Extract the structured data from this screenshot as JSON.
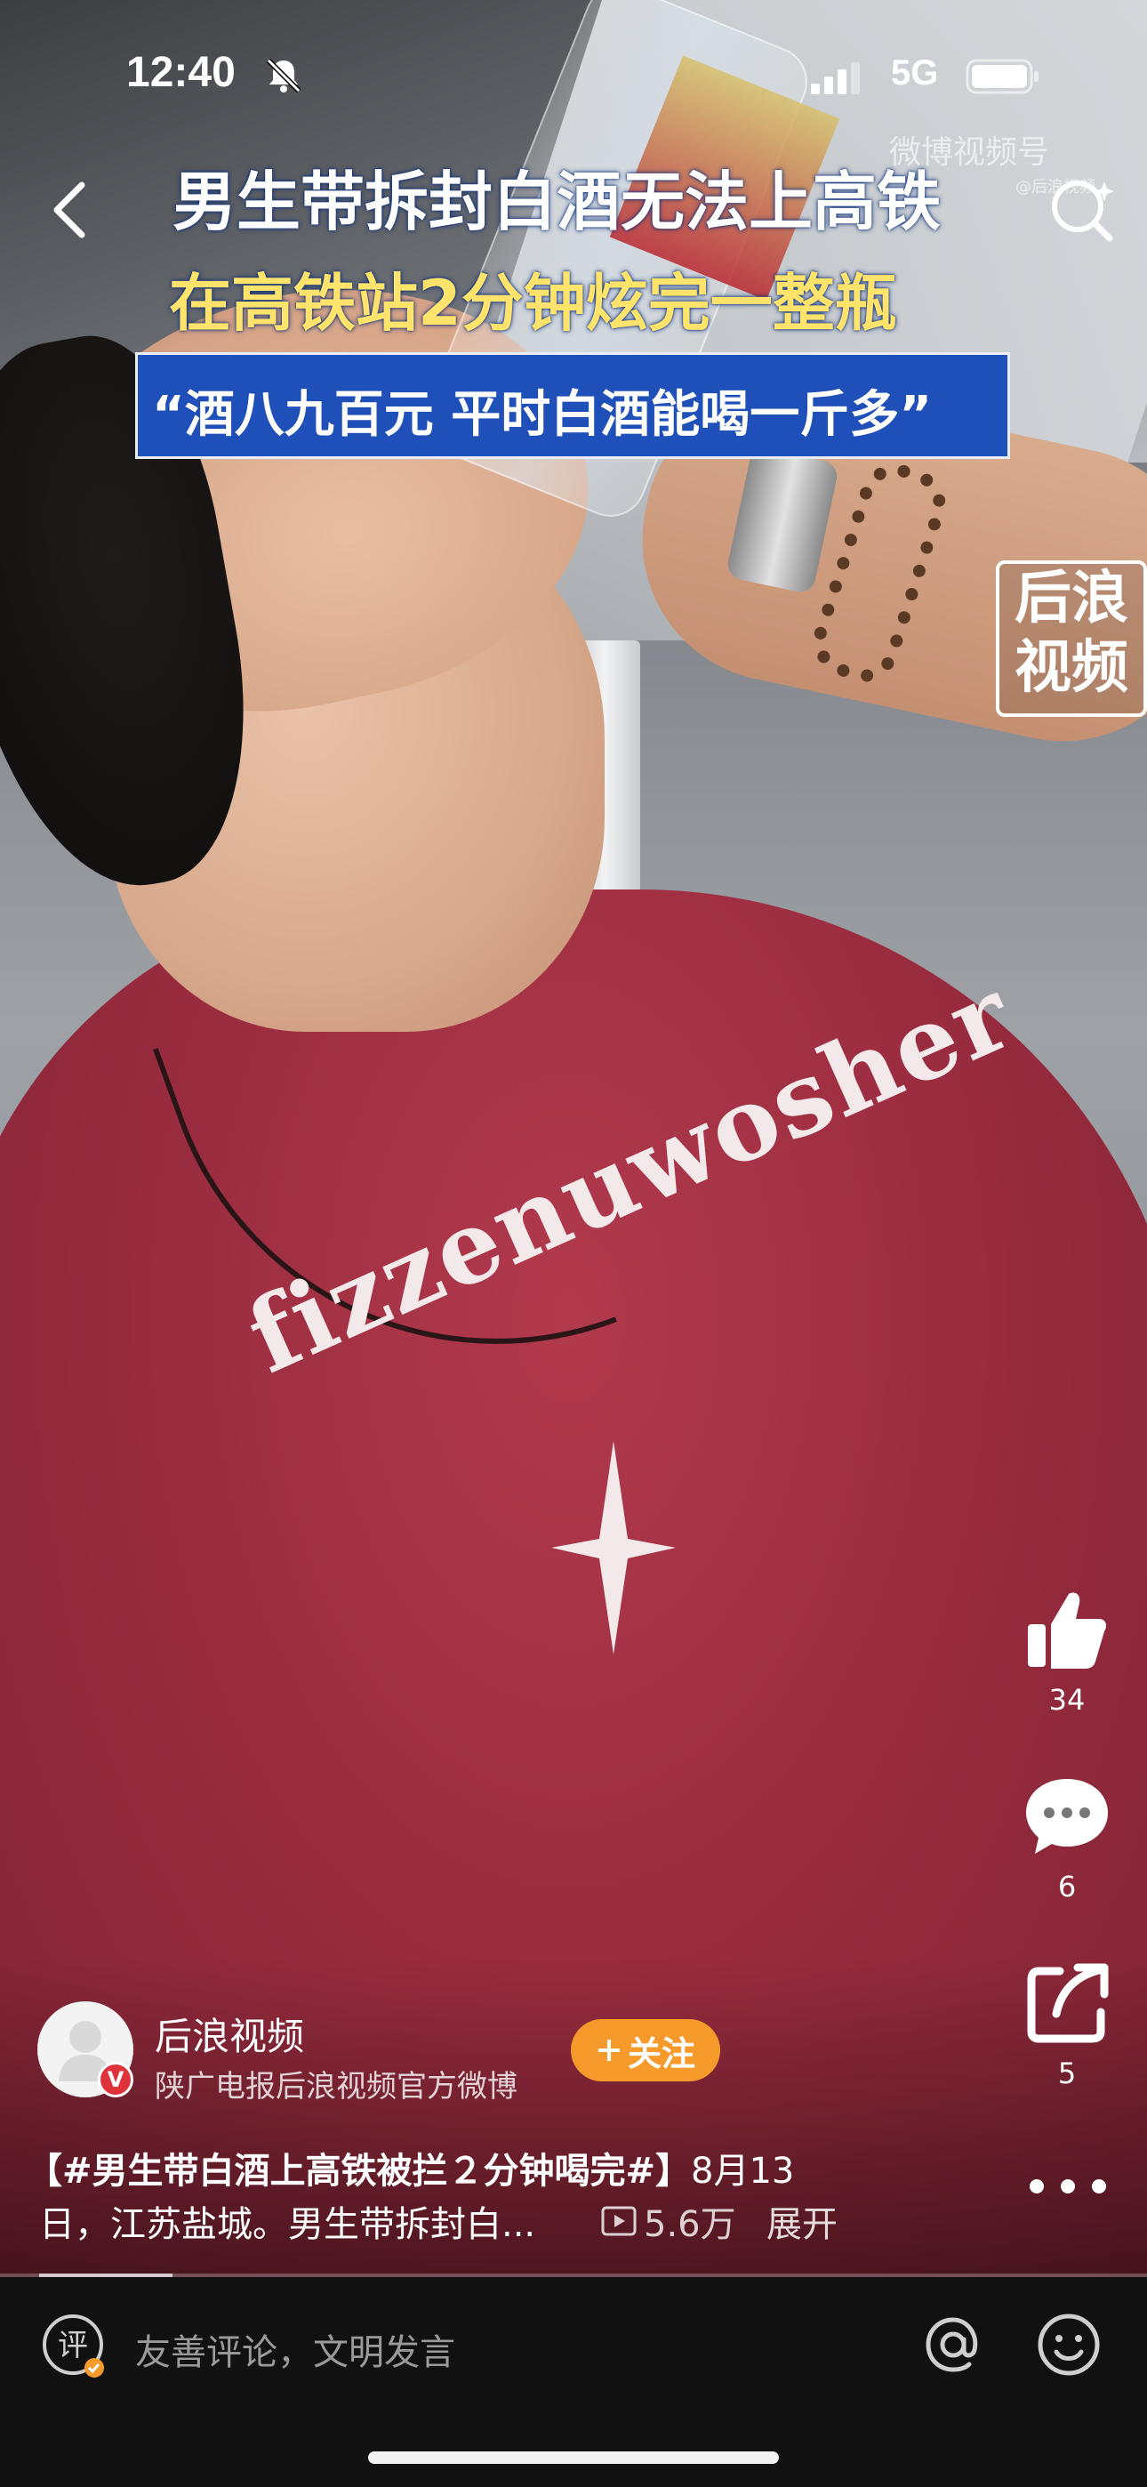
{
  "status_bar": {
    "time": "12:40",
    "network": "5G",
    "icons": [
      "mute-bell-icon",
      "signal-icon",
      "battery-icon"
    ]
  },
  "overlay": {
    "watermark": "微博视频号",
    "watermark_sub": "@后浪视频",
    "headline_line1": "男生带拆封白酒无法上高铁",
    "headline_line2": "在高铁站2分钟炫完一整瓶",
    "quote": "“酒八九百元 平时白酒能喝一斤多”",
    "channel_logo": [
      "后浪",
      "视频"
    ],
    "shirt_print": "fizzenuwosher"
  },
  "actions": {
    "like_count": "34",
    "comment_count": "6",
    "share_count": "5"
  },
  "author": {
    "name": "后浪视频",
    "description": "陕广电报后浪视频官方微博",
    "verified_badge": "V",
    "follow_label": "关注"
  },
  "caption": {
    "hashtag": "【#男生带白酒上高铁被拦２分钟喝完#】",
    "line1_rest": "8月13",
    "line2": "日，江苏盐城。男生带拆封白...",
    "play_count": "5.6万",
    "expand_label": "展开"
  },
  "comment_bar": {
    "placeholder": "友善评论，文明发言",
    "comment_icon_label": "评"
  },
  "colors": {
    "follow_button": "#f59a2b",
    "verified": "#e0323a",
    "quote_box": "#1f4fb8",
    "headline_yellow": "#ffe36b"
  }
}
